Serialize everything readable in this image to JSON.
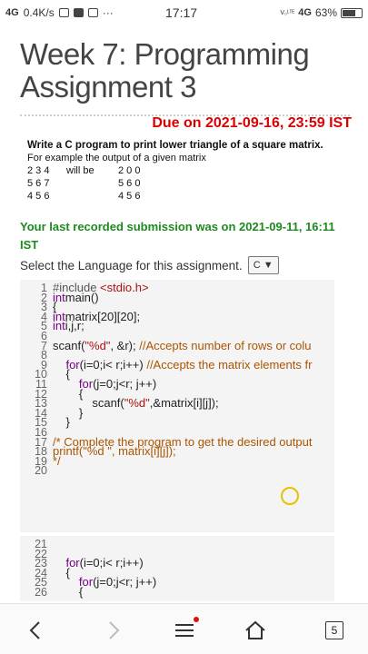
{
  "status_bar": {
    "network": "4G",
    "speed": "0.4K/s",
    "time": "17:17",
    "volte": "VoLTE",
    "network_right": "4G",
    "battery": "63%"
  },
  "page": {
    "title": "Week 7: Programming Assignment 3",
    "due": "Due on 2021-09-16, 23:59 IST",
    "problem_title": "Write a C program to print lower triangle of a square matrix.",
    "problem_example": "For example the output of a given matrix",
    "matrix_rows": [
      {
        "left": "2 3 4",
        "mid": "will be",
        "right": "2 0 0"
      },
      {
        "left": "5 6 7",
        "mid": "",
        "right": "5 6 0"
      },
      {
        "left": "4 5 6",
        "mid": "",
        "right": "4 5 6"
      }
    ],
    "submission_line1": "Your last recorded submission was on 2021-09-11, 16:11",
    "submission_line2": "IST",
    "language_label": "Select the Language for this assignment.",
    "language_value": "C"
  },
  "editor": {
    "line_numbers": [
      "1",
      "2",
      "3",
      "4",
      "5",
      "6",
      "7",
      "8",
      "9",
      "10",
      "11",
      "12",
      "13",
      "14",
      "15",
      "16",
      "17",
      "18",
      "19",
      "20"
    ],
    "line_numbers_2": [
      "21",
      "22",
      "23",
      "24",
      "25",
      "26"
    ]
  },
  "colors": {
    "due": "#dd0000",
    "submission": "#1c8a1c",
    "keyword": "#770088"
  },
  "nav": {
    "tab_count": "5"
  }
}
